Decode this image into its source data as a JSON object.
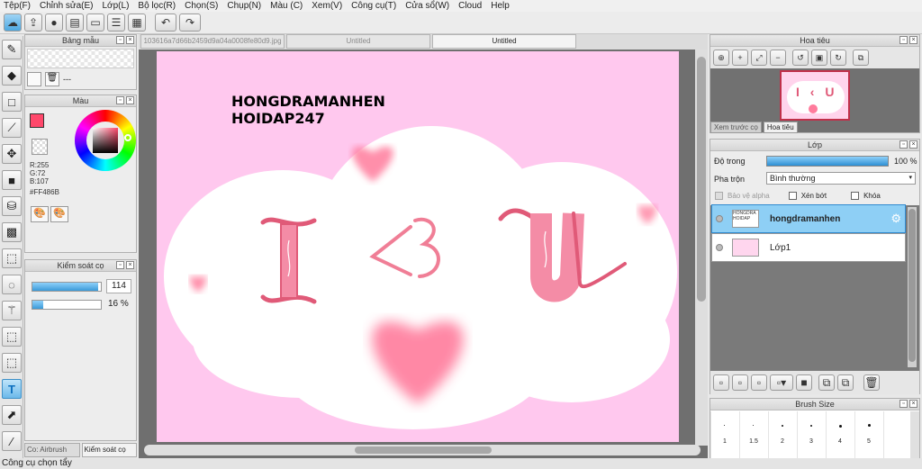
{
  "menu": [
    "Tệp(F)",
    "Chỉnh sửa(E)",
    "Lớp(L)",
    "Bộ lọc(R)",
    "Chọn(S)",
    "Chụp(N)",
    "Màu (C)",
    "Xem(V)",
    "Công cụ(T)",
    "Cửa sổ(W)",
    "Cloud",
    "Help"
  ],
  "toolbar_icons": [
    "cloud-icon",
    "export-icon",
    "chat-icon",
    "template-icon",
    "document-icon",
    "list-icon",
    "grid-icon",
    "undo-icon",
    "redo-icon"
  ],
  "tools": [
    "brush-icon",
    "eraser-icon",
    "rectangle-select-icon",
    "line-icon",
    "move-icon",
    "fill-rect-icon",
    "bucket-icon",
    "gradient-icon",
    "select-dotted-icon",
    "lasso-icon",
    "magic-wand-icon",
    "select-pen-icon",
    "select-eraser-icon",
    "text-icon",
    "pointer-icon",
    "eyedropper-icon"
  ],
  "pattern_panel": {
    "title": "Bảng mẫu",
    "item": "---"
  },
  "color_panel": {
    "title": "Màu",
    "r": "R:255",
    "g": "G:72",
    "b": "B:107",
    "hex": "#FF486B",
    "primary": "#FF486B"
  },
  "brush_control": {
    "title": "Kiểm soát cọ",
    "size": "114",
    "opacity": "16 %"
  },
  "bottom_tabs": [
    "Co: Airbrush",
    "Kiểm soát cọ"
  ],
  "document_tabs": [
    "103616a7d66b2459d9a04a0008fe80d9.jpg",
    "Untitled",
    "Untitled"
  ],
  "canvas": {
    "line1": "HONGDRAMANHEN",
    "line2": "HOIDAP247",
    "ltr_i": "I",
    "heart_sym": "<3",
    "ltr_u": "U",
    "bg": "#FFC8EE"
  },
  "navigator": {
    "title": "Hoa tiêu",
    "tabs": [
      "Xem trước cọ",
      "Hoa tiêu"
    ]
  },
  "layer_panel": {
    "title": "Lớp",
    "opacity_label": "Độ trong",
    "opacity_value": "100 %",
    "blend_label": "Pha trộn",
    "blend_value": "Bình thường",
    "protect_alpha": "Bảo vệ alpha",
    "clip": "Xén bớt",
    "lock": "Khóa",
    "layers": [
      {
        "name": "hongdramanhen",
        "selected": true
      },
      {
        "name": "Lớp1",
        "selected": false
      }
    ]
  },
  "brush_size": {
    "title": "Brush Size",
    "labels": [
      "1",
      "1.5",
      "2",
      "3",
      "4",
      "5"
    ]
  },
  "status": "Công cụ chọn tẩy"
}
